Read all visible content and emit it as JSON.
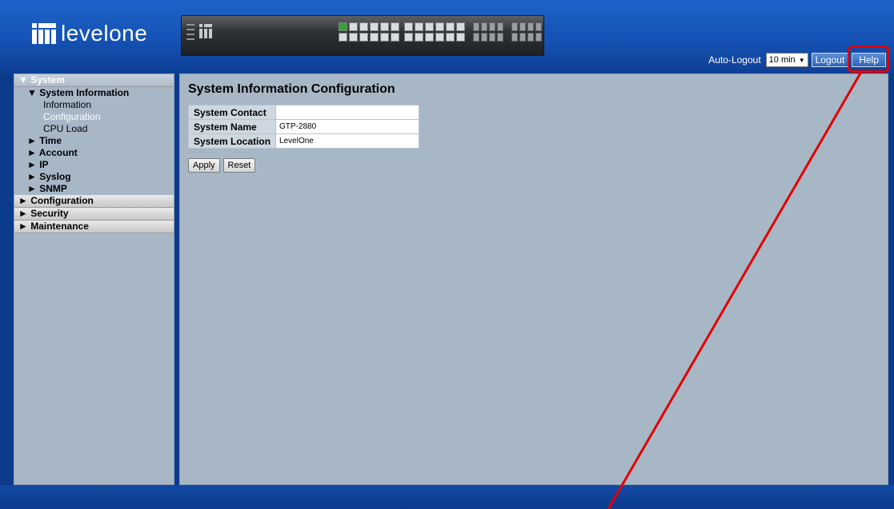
{
  "header": {
    "brand": "levelone",
    "autologout_label": "Auto-Logout",
    "autologout_value": "10 min",
    "logout_label": "Logout",
    "help_label": "Help"
  },
  "nav": {
    "system": "▼ System",
    "system_information": "▼ System Information",
    "information": "Information",
    "configuration_leaf": "Configuration",
    "cpu_load": "CPU Load",
    "time": "► Time",
    "account": "► Account",
    "ip": "► IP",
    "syslog": "► Syslog",
    "snmp": "► SNMP",
    "configuration": "► Configuration",
    "security": "► Security",
    "maintenance": "► Maintenance"
  },
  "main": {
    "title": "System Information Configuration",
    "fields": {
      "contact_label": "System Contact",
      "contact_value": "",
      "name_label": "System Name",
      "name_value": "GTP-2880",
      "location_label": "System Location",
      "location_value": "LevelOne"
    },
    "apply_label": "Apply",
    "reset_label": "Reset"
  },
  "colors": {
    "annotation": "#e10000",
    "panel": "#a7b7c6",
    "header": "#1552b4"
  }
}
